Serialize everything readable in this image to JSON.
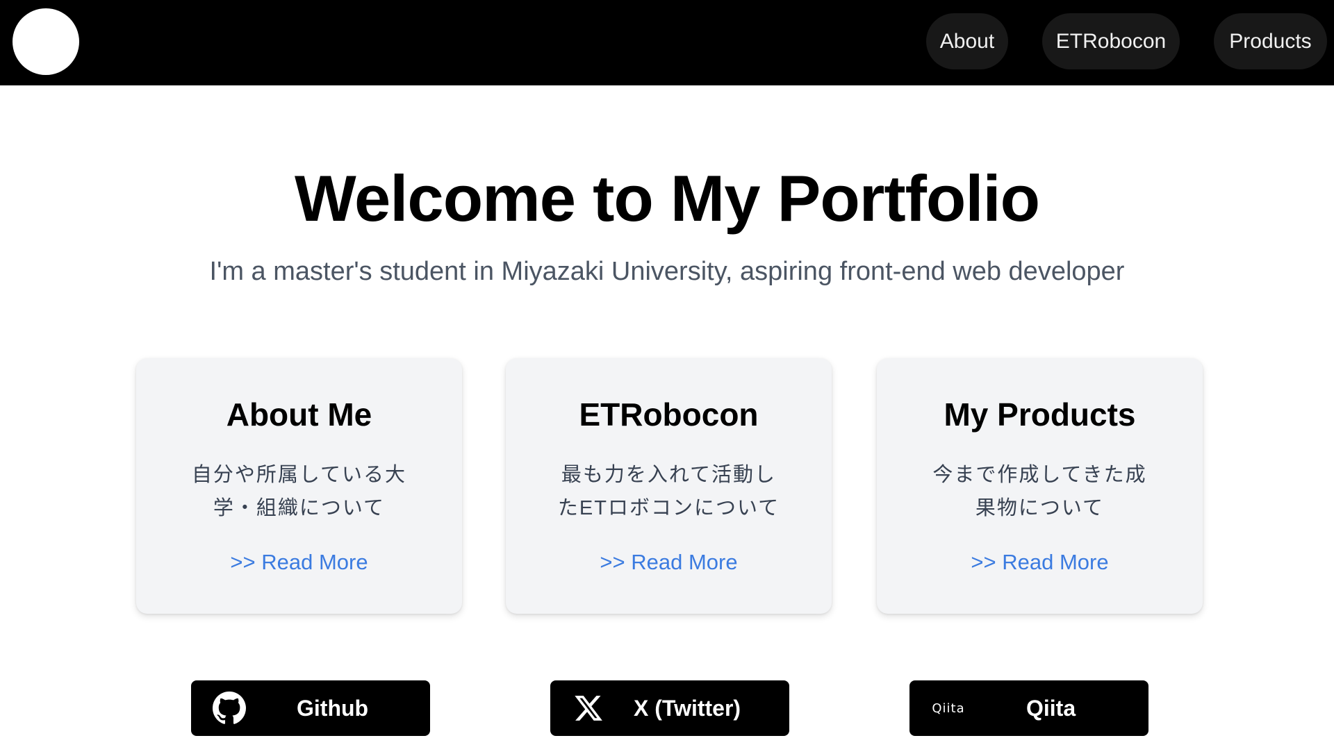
{
  "header": {
    "nav": [
      {
        "label": "About"
      },
      {
        "label": "ETRobocon"
      },
      {
        "label": "Products"
      }
    ]
  },
  "hero": {
    "title": "Welcome to My Portfolio",
    "subtitle": "I'm a master's student in Miyazaki University, aspiring front-end web developer"
  },
  "cards": [
    {
      "title": "About Me",
      "description": "自分や所属している大学・組織について",
      "link": ">> Read More"
    },
    {
      "title": "ETRobocon",
      "description": "最も力を入れて活動したETロボコンについて",
      "link": ">> Read More"
    },
    {
      "title": "My Products",
      "description": "今まで作成してきた成果物について",
      "link": ">> Read More"
    }
  ],
  "social": [
    {
      "label": "Github",
      "icon": "github-icon"
    },
    {
      "label": "X (Twitter)",
      "icon": "x-icon"
    },
    {
      "label": "Qiita",
      "icon": "qiita-icon",
      "icon_text": "Qiita"
    }
  ],
  "colors": {
    "header_bg": "#000000",
    "nav_pill_bg": "#181818",
    "card_bg": "#f3f4f6",
    "link": "#3b7be0",
    "subtitle": "#4b5563",
    "button_bg": "#000000"
  }
}
